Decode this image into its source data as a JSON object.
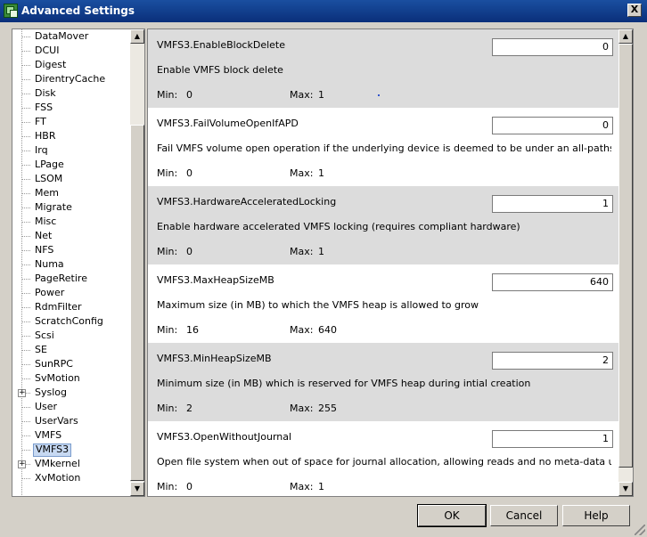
{
  "window": {
    "title": "Advanced Settings",
    "close_glyph": "X"
  },
  "tree": {
    "items": [
      {
        "label": "DataMover",
        "expandable": false,
        "selected": false
      },
      {
        "label": "DCUI",
        "expandable": false,
        "selected": false
      },
      {
        "label": "Digest",
        "expandable": false,
        "selected": false
      },
      {
        "label": "DirentryCache",
        "expandable": false,
        "selected": false
      },
      {
        "label": "Disk",
        "expandable": false,
        "selected": false
      },
      {
        "label": "FSS",
        "expandable": false,
        "selected": false
      },
      {
        "label": "FT",
        "expandable": false,
        "selected": false
      },
      {
        "label": "HBR",
        "expandable": false,
        "selected": false
      },
      {
        "label": "Irq",
        "expandable": false,
        "selected": false
      },
      {
        "label": "LPage",
        "expandable": false,
        "selected": false
      },
      {
        "label": "LSOM",
        "expandable": false,
        "selected": false
      },
      {
        "label": "Mem",
        "expandable": false,
        "selected": false
      },
      {
        "label": "Migrate",
        "expandable": false,
        "selected": false
      },
      {
        "label": "Misc",
        "expandable": false,
        "selected": false
      },
      {
        "label": "Net",
        "expandable": false,
        "selected": false
      },
      {
        "label": "NFS",
        "expandable": false,
        "selected": false
      },
      {
        "label": "Numa",
        "expandable": false,
        "selected": false
      },
      {
        "label": "PageRetire",
        "expandable": false,
        "selected": false
      },
      {
        "label": "Power",
        "expandable": false,
        "selected": false
      },
      {
        "label": "RdmFilter",
        "expandable": false,
        "selected": false
      },
      {
        "label": "ScratchConfig",
        "expandable": false,
        "selected": false
      },
      {
        "label": "Scsi",
        "expandable": false,
        "selected": false
      },
      {
        "label": "SE",
        "expandable": false,
        "selected": false
      },
      {
        "label": "SunRPC",
        "expandable": false,
        "selected": false
      },
      {
        "label": "SvMotion",
        "expandable": false,
        "selected": false
      },
      {
        "label": "Syslog",
        "expandable": true,
        "selected": false
      },
      {
        "label": "User",
        "expandable": false,
        "selected": false
      },
      {
        "label": "UserVars",
        "expandable": false,
        "selected": false
      },
      {
        "label": "VMFS",
        "expandable": false,
        "selected": false
      },
      {
        "label": "VMFS3",
        "expandable": false,
        "selected": true
      },
      {
        "label": "VMkernel",
        "expandable": true,
        "selected": false
      },
      {
        "label": "XvMotion",
        "expandable": false,
        "selected": false
      }
    ],
    "expand_glyph": "+"
  },
  "settings": {
    "min_label": "Min:",
    "max_label": "Max:",
    "items": [
      {
        "name": "VMFS3.EnableBlockDelete",
        "value": "0",
        "description": "Enable VMFS block delete",
        "min": "0",
        "max": "1"
      },
      {
        "name": "VMFS3.FailVolumeOpenIfAPD",
        "value": "0",
        "description": "Fail VMFS volume open operation if the underlying device is deemed to be under an all-paths-down ...",
        "min": "0",
        "max": "1"
      },
      {
        "name": "VMFS3.HardwareAcceleratedLocking",
        "value": "1",
        "description": "Enable hardware accelerated VMFS locking (requires compliant hardware)",
        "min": "0",
        "max": "1"
      },
      {
        "name": "VMFS3.MaxHeapSizeMB",
        "value": "640",
        "description": "Maximum size (in MB) to which the VMFS heap is allowed to grow",
        "min": "16",
        "max": "640"
      },
      {
        "name": "VMFS3.MinHeapSizeMB",
        "value": "2",
        "description": "Minimum size (in MB) which is reserved for VMFS heap during intial creation",
        "min": "2",
        "max": "255"
      },
      {
        "name": "VMFS3.OpenWithoutJournal",
        "value": "1",
        "description": "Open file system when out of space for journal allocation, allowing reads and no meta-data updates",
        "min": "0",
        "max": "1"
      }
    ]
  },
  "scroll_glyphs": {
    "up": "▲",
    "down": "▼"
  },
  "buttons": {
    "ok": "OK",
    "cancel": "Cancel",
    "help": "Help"
  }
}
